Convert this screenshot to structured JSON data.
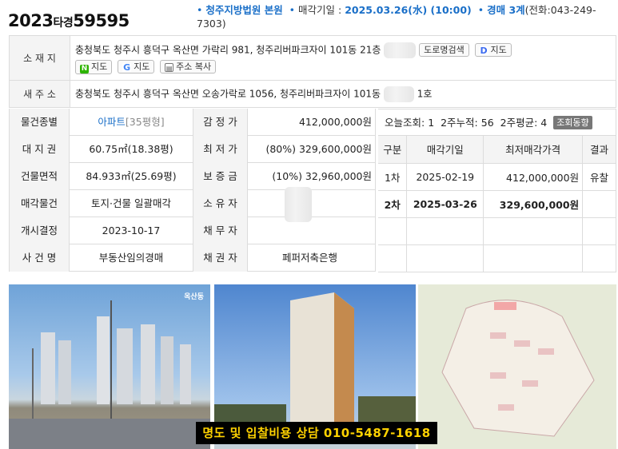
{
  "case": {
    "year": "2023",
    "type": "타경",
    "number": "59595"
  },
  "header": {
    "court": "청주지방법원 본원",
    "sale_date_label": "매각기일 :",
    "sale_date": "2025.03.26(水) (10:00)",
    "dept": "경매 3계",
    "phone": "(전화:043-249-7303)"
  },
  "address": {
    "label": "소 재 지",
    "value": "충청북도 청주시 흥덕구 옥산면 가락리 981, 청주리버파크자이 101동 21층",
    "road_search_btn": "도로명검색",
    "daum_map_btn": "지도",
    "naver_map_btn": "지도",
    "google_map_btn": "지도",
    "copy_btn": "주소 복사"
  },
  "new_address": {
    "label": "새 주 소",
    "value": "충청북도 청주시 흥덕구 옥산면 오송가락로 1056, 청주리버파크자이 101동",
    "suffix": "1호"
  },
  "details": [
    {
      "label": "물건종별",
      "value": "아파트",
      "value_extra": "[35평형]",
      "label2": "감 정 가",
      "value2": "412,000,000원"
    },
    {
      "label": "대 지 권",
      "value": "60.75㎡(18.38평)",
      "label2": "최 저 가",
      "value2": "(80%) 329,600,000원"
    },
    {
      "label": "건물면적",
      "value": "84.933㎡(25.69평)",
      "label2": "보 증 금",
      "value2": "(10%) 32,960,000원"
    },
    {
      "label": "매각물건",
      "value": "토지·건물 일괄매각",
      "label2": "소 유 자",
      "value2": ""
    },
    {
      "label": "개시결정",
      "value": "2023-10-17",
      "label2": "채 무 자",
      "value2": ""
    },
    {
      "label": "사 건 명",
      "value": "부동산임의경매",
      "label2": "채 권 자",
      "value2": "페퍼저축은행"
    }
  ],
  "views": {
    "today_label": "오늘조회:",
    "today": "1",
    "two_week_label": "2주누적:",
    "two_week": "56",
    "avg_label": "2주평균:",
    "avg": "4",
    "btn": "조회동향"
  },
  "history": {
    "headers": [
      "구분",
      "매각기일",
      "최저매각가격",
      "결과"
    ],
    "rows": [
      {
        "round": "1차",
        "date": "2025-02-19",
        "price": "412,000,000원",
        "result": "유찰"
      },
      {
        "round": "2차",
        "date": "2025-03-26",
        "price": "329,600,000원",
        "result": ""
      }
    ]
  },
  "photos": {
    "brand": "옥산동",
    "banner": "명도 및 입찰비용 상담 010-5487-1618"
  }
}
